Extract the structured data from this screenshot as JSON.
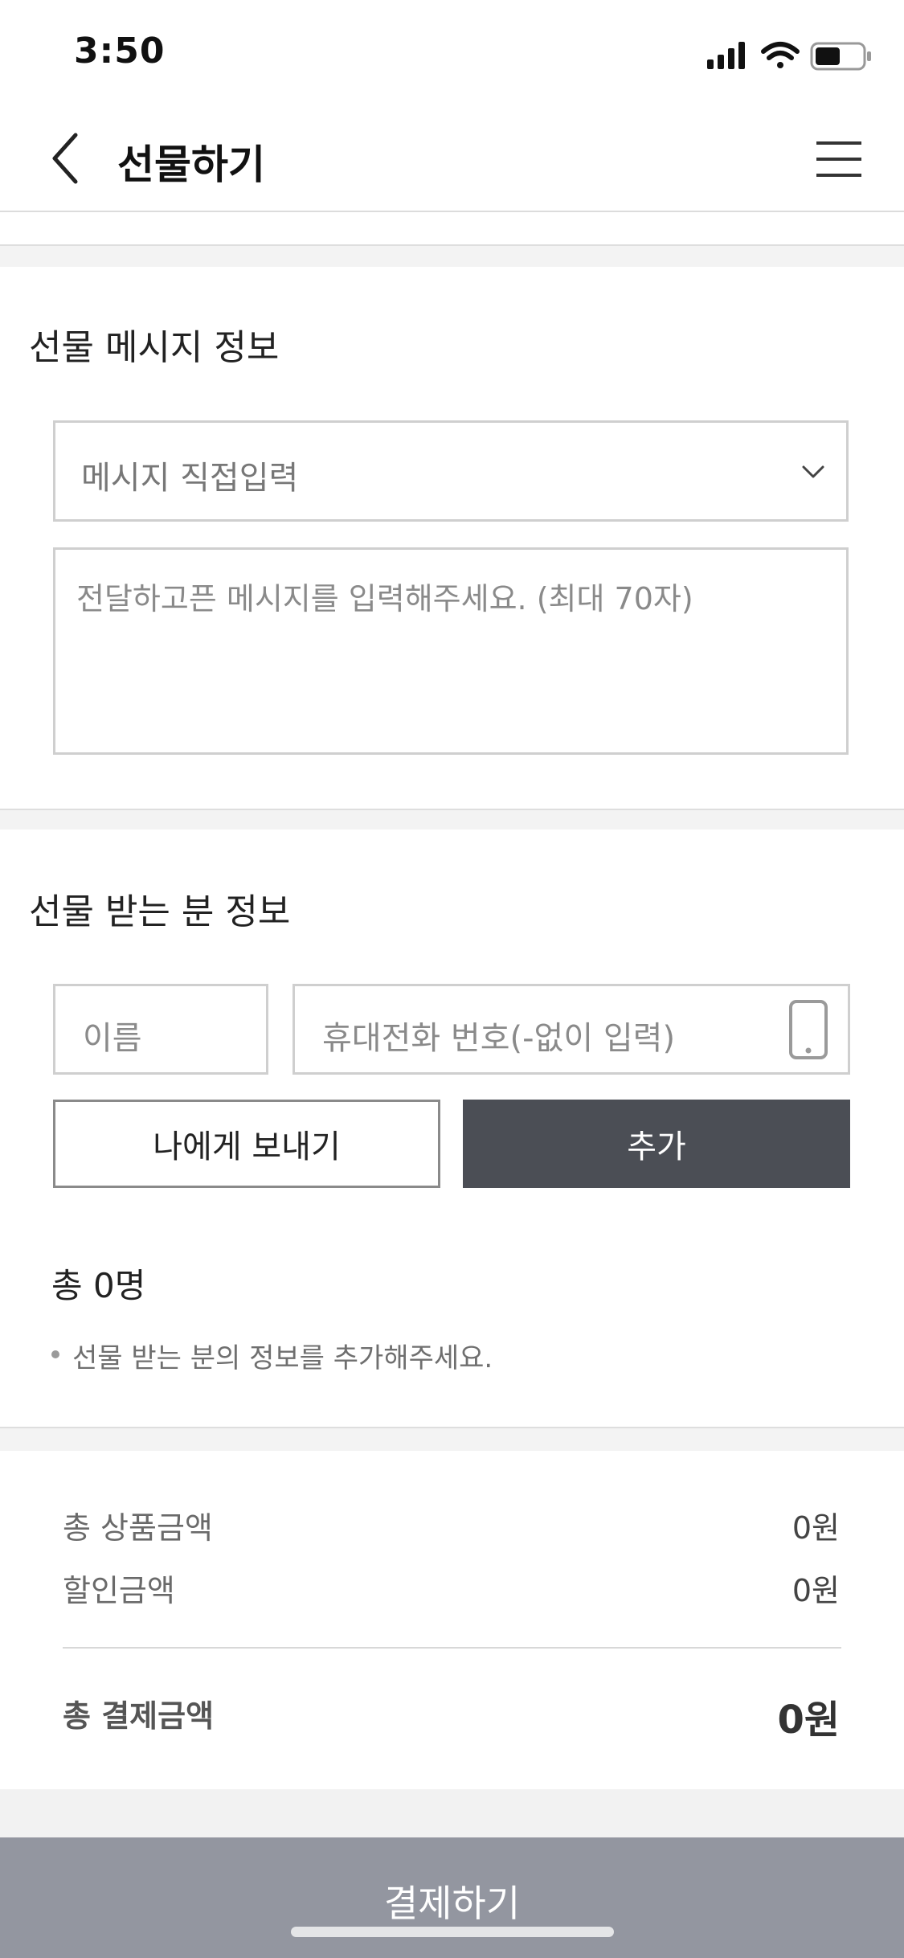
{
  "status_bar": {
    "time": "3:50",
    "icons": [
      "signal-icon",
      "wifi-icon",
      "battery-icon"
    ]
  },
  "header": {
    "title": "선물하기",
    "back_icon": "chevron-left-icon",
    "menu_icon": "hamburger-menu-icon"
  },
  "message_section": {
    "title": "선물 메시지 정보",
    "select_value": "메시지 직접입력",
    "textarea_placeholder": "전달하고픈 메시지를 입력해주세요. (최대 70자)"
  },
  "recipient_section": {
    "title": "선물 받는 분 정보",
    "name_placeholder": "이름",
    "phone_placeholder": "휴대전화 번호(-없이 입력)",
    "send_to_self_label": "나에게 보내기",
    "add_label": "추가",
    "total_count": "총 0명",
    "guide": "선물 받는 분의 정보를 추가해주세요."
  },
  "payment_summary": {
    "rows": [
      {
        "label": "총 상품금액",
        "value": "0원"
      },
      {
        "label": "할인금액",
        "value": "0원"
      }
    ],
    "total_label": "총 결제금액",
    "total_value": "0원"
  },
  "pay_button": {
    "label": "결제하기"
  },
  "colors": {
    "add_button_bg": "#4b4e55",
    "pay_button_bg": "#9396a0",
    "border": "#cfcfcf"
  }
}
